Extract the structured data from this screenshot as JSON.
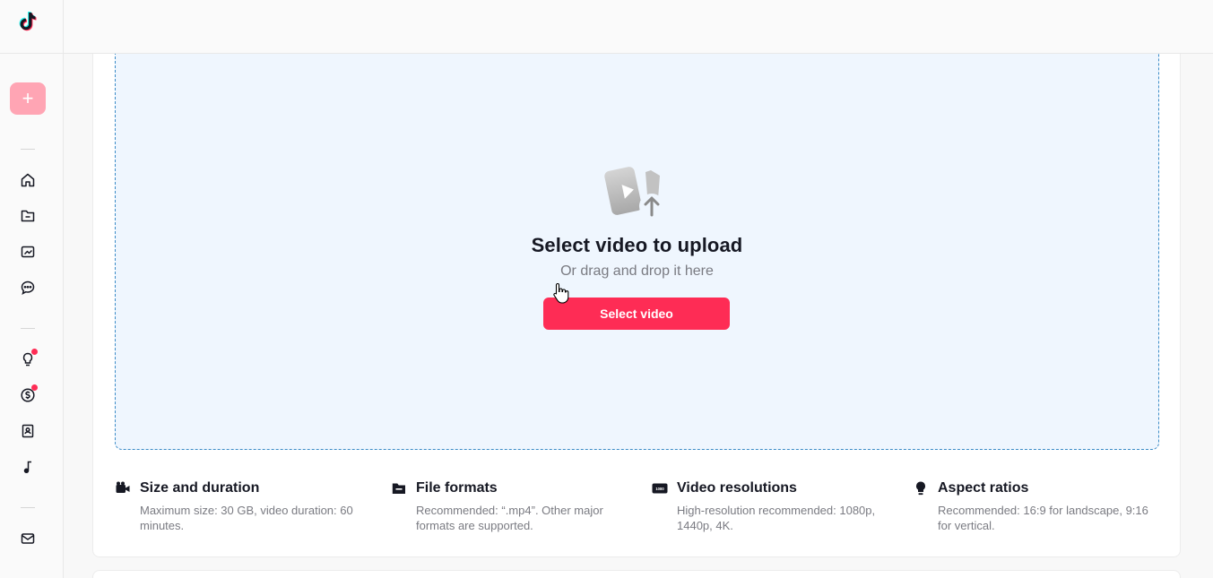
{
  "sidebar": {
    "logo_icon": "tiktok-logo",
    "upload_icon": "+",
    "items": [
      {
        "icon": "home-icon"
      },
      {
        "icon": "folder-icon"
      },
      {
        "icon": "analytics-icon"
      },
      {
        "icon": "comments-icon"
      },
      {
        "icon": "lightbulb-icon",
        "notification": true
      },
      {
        "icon": "dollar-icon",
        "notification": true
      },
      {
        "icon": "book-icon"
      },
      {
        "icon": "music-icon"
      },
      {
        "icon": "mail-icon"
      }
    ]
  },
  "upload": {
    "title": "Select video to upload",
    "subtitle": "Or drag and drop it here",
    "button_label": "Select video"
  },
  "info": [
    {
      "icon": "camera-icon",
      "title": "Size and duration",
      "desc": "Maximum size: 30 GB, video duration: 60 minutes."
    },
    {
      "icon": "folder-icon",
      "title": "File formats",
      "desc": "Recommended: “.mp4”. Other major formats are supported."
    },
    {
      "icon": "resolution-icon",
      "title": "Video resolutions",
      "desc": "High-resolution recommended: 1080p, 1440p, 4K."
    },
    {
      "icon": "lightbulb-icon",
      "title": "Aspect ratios",
      "desc": "Recommended: 16:9 for landscape, 9:16 for vertical."
    }
  ],
  "colors": {
    "accent": "#fe2c55",
    "upload_button_bg": "#ffa5b4",
    "dropzone_bg": "#eff6fe",
    "dropzone_border": "#3b8bc7"
  }
}
